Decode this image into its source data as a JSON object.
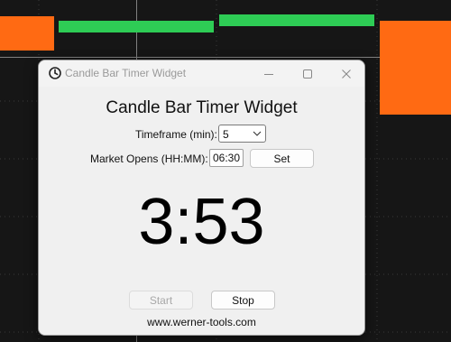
{
  "window": {
    "title": "Candle Bar Timer Widget"
  },
  "widget": {
    "heading": "Candle Bar Timer Widget",
    "timeframe_label": "Timeframe (min):",
    "timeframe_value": "5",
    "market_opens_label": "Market Opens (HH:MM):",
    "market_opens_value": "06:30",
    "set_label": "Set",
    "countdown": "3:53",
    "start_label": "Start",
    "stop_label": "Stop",
    "footer_link": "www.werner-tools.com"
  },
  "colors": {
    "background": "#161616",
    "bullish_candle": "#2ecc55",
    "bearish_candle": "#ff6a13",
    "grid_line": "#3a3a3a",
    "crosshair": "#c8c8c8"
  },
  "icons": {
    "title_icon": "clock-icon",
    "minimize": "minimize-icon",
    "maximize": "maximize-icon",
    "close": "close-icon",
    "combo_arrow": "chevron-down-icon"
  }
}
